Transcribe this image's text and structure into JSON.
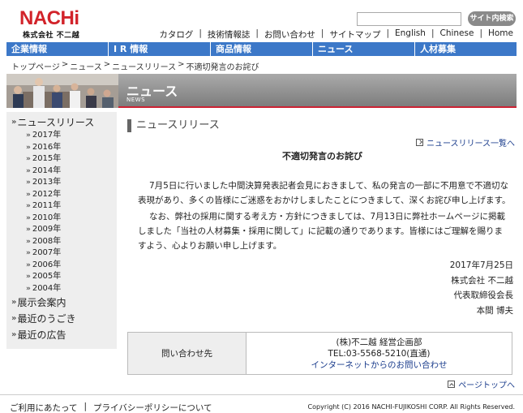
{
  "header": {
    "logo_text": "NACHi",
    "company": "株式会社 不二越",
    "search_placeholder": "",
    "search_button": "サイト内検索",
    "util_links": [
      "カタログ",
      "技術情報誌",
      "お問い合わせ",
      "サイトマップ",
      "English",
      "Chinese",
      "Home"
    ]
  },
  "main_nav": [
    "企業情報",
    "I R 情報",
    "商品情報",
    "ニュース",
    "人材募集"
  ],
  "breadcrumb": [
    "トップページ",
    "ニュース",
    "ニュースリリース",
    "不適切発言のお詫び"
  ],
  "banner": {
    "title": "ニュース",
    "subtitle": "NEWS"
  },
  "sidebar": {
    "news_release": "ニュースリリース",
    "years": [
      "2017年",
      "2016年",
      "2015年",
      "2014年",
      "2013年",
      "2012年",
      "2011年",
      "2010年",
      "2009年",
      "2008年",
      "2007年",
      "2006年",
      "2005年",
      "2004年"
    ],
    "other_sections": [
      "展示会案内",
      "最近のうごき",
      "最近の広告"
    ]
  },
  "content": {
    "section_heading": "ニュースリリース",
    "list_link": "ニュースリリース一覧へ",
    "title": "不適切発言のお詫び",
    "para1": "7月5日に行いました中間決算発表記者会見におきまして、私の発言の一部に不用意で不適切な表現があり、多くの皆様にご迷惑をおかけしましたことにつきまして、深くお詫び申し上げます。",
    "para2": "なお、弊社の採用に関する考え方・方針につきましては、7月13日に弊社ホームページに掲載しました「当社の人材募集・採用に関して」に記載の通りであります。皆様にはご理解を賜りますよう、心よりお願い申し上げます。",
    "date": "2017年7月25日",
    "company": "株式会社 不二越",
    "position": "代表取締役会長",
    "name": "本間 博夫"
  },
  "contact": {
    "label": "問い合わせ先",
    "dept": "(株)不二越 経営企画部",
    "tel": "TEL:03-5568-5210(直通)",
    "link": "インターネットからのお問い合わせ"
  },
  "page_top": "ページトップへ",
  "footer": {
    "links": [
      "ご利用にあたって",
      "プライバシーポリシーについて"
    ],
    "copyright": "Copyright (C) 2016 NACHI-FUJIKOSHI CORP. All Rights Reserved."
  },
  "colors": {
    "brand_red": "#d2232a",
    "nav_blue": "#3c78c8",
    "link_blue": "#1a3c8c"
  }
}
